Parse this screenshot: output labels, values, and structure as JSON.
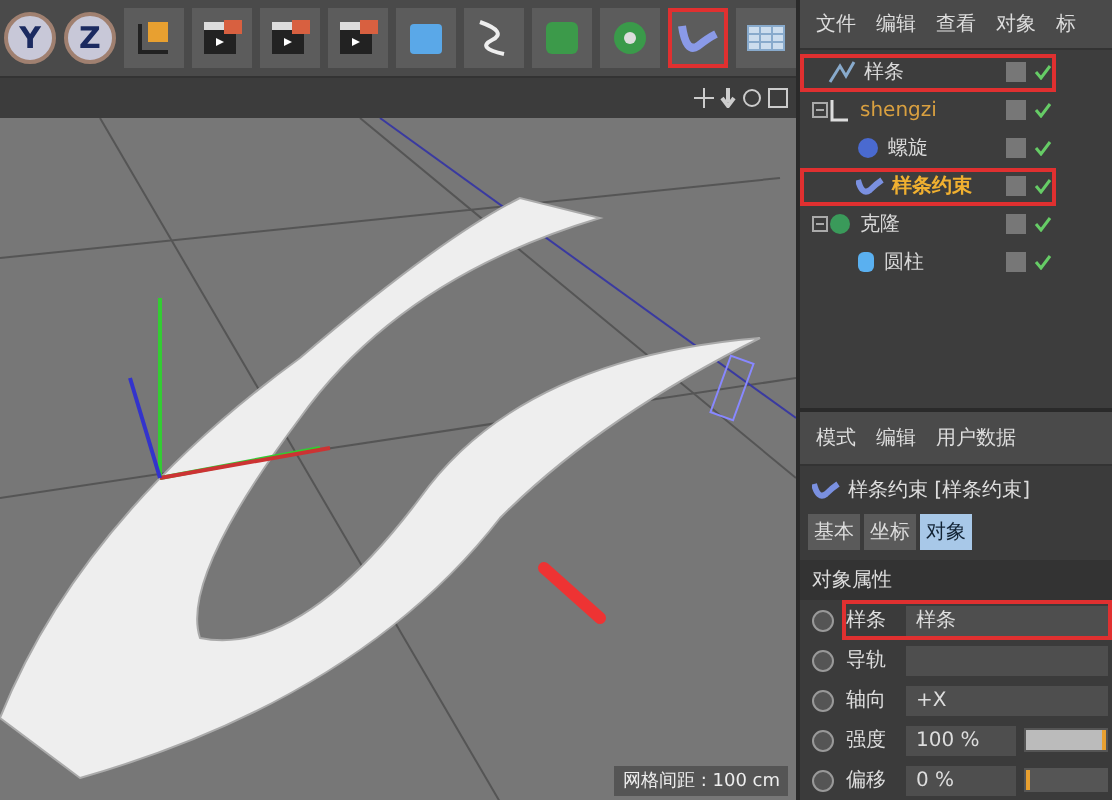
{
  "toolbar": {
    "axis_buttons": [
      {
        "label": "Y"
      },
      {
        "label": "Z"
      }
    ],
    "tools": [
      {
        "kind": "axis",
        "highlighted": false
      },
      {
        "kind": "render",
        "highlighted": false
      },
      {
        "kind": "render",
        "highlighted": false
      },
      {
        "kind": "render",
        "highlighted": false
      },
      {
        "kind": "cube",
        "highlighted": false
      },
      {
        "kind": "pen",
        "highlighted": false
      },
      {
        "kind": "deformer",
        "highlighted": false
      },
      {
        "kind": "array",
        "highlighted": false
      },
      {
        "kind": "constraint",
        "highlighted": true
      },
      {
        "kind": "plane",
        "highlighted": false
      }
    ]
  },
  "viewport": {
    "grid_label": "网格间距 : 100 cm"
  },
  "object_manager": {
    "menu": [
      "文件",
      "编辑",
      "查看",
      "对象",
      "标"
    ],
    "tree": [
      {
        "name": "样条",
        "kind": "spline",
        "highlighted": true,
        "selected": false
      },
      {
        "name": "shengzi",
        "kind": "null",
        "highlighted": false,
        "selected": false,
        "expanded": true,
        "children": [
          {
            "name": "螺旋",
            "kind": "helix",
            "highlighted": false,
            "selected": false
          },
          {
            "name": "样条约束",
            "kind": "constraint",
            "highlighted": true,
            "selected": true
          }
        ]
      },
      {
        "name": "克隆",
        "kind": "cloner",
        "highlighted": false,
        "selected": false,
        "expanded": true,
        "children": [
          {
            "name": "圆柱",
            "kind": "cylinder",
            "highlighted": false,
            "selected": false
          }
        ]
      }
    ]
  },
  "attributes": {
    "menu": [
      "模式",
      "编辑",
      "用户数据"
    ],
    "title": "样条约束 [样条约束]",
    "tabs": [
      {
        "label": "基本",
        "selected": false
      },
      {
        "label": "坐标",
        "selected": false
      },
      {
        "label": "对象",
        "selected": true
      }
    ],
    "section": "对象属性",
    "fields": [
      {
        "kind": "link",
        "label": "样条",
        "value": "样条",
        "highlighted": true,
        "keyframed": false
      },
      {
        "kind": "link",
        "label": "导轨",
        "highlighted": false,
        "keyframed": false
      },
      {
        "kind": "select",
        "label": "轴向",
        "value": "+X",
        "highlighted": false,
        "keyframed": false
      },
      {
        "kind": "slider",
        "label": "强度",
        "value": "100 %",
        "level": 1,
        "highlighted": false,
        "keyframed": false
      },
      {
        "kind": "slider",
        "label": "偏移",
        "value": "0 %",
        "level": 0,
        "highlighted": false,
        "keyframed": false
      }
    ]
  }
}
